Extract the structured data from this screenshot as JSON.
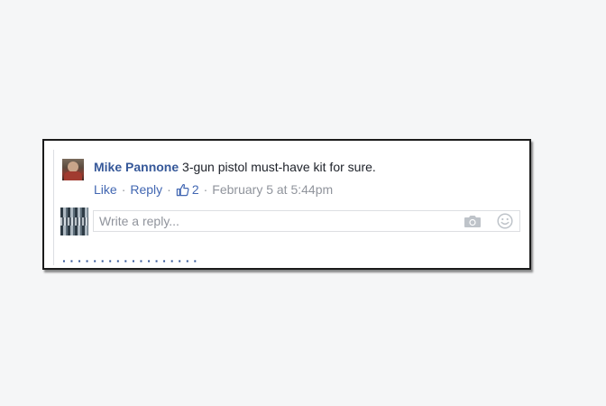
{
  "comment": {
    "author": "Mike Pannone",
    "text": " 3-gun pistol must-have kit for sure.",
    "actions": {
      "like": "Like",
      "reply": "Reply",
      "like_count": "2",
      "timestamp": "February 5 at 5:44pm",
      "separator": "·"
    }
  },
  "reply_box": {
    "placeholder": "Write a reply...",
    "camera_icon": "camera-icon",
    "emoji_icon": "smile-icon"
  },
  "colors": {
    "link": "#4267b2",
    "author": "#365899",
    "meta": "#90949c",
    "text": "#1d2129"
  }
}
